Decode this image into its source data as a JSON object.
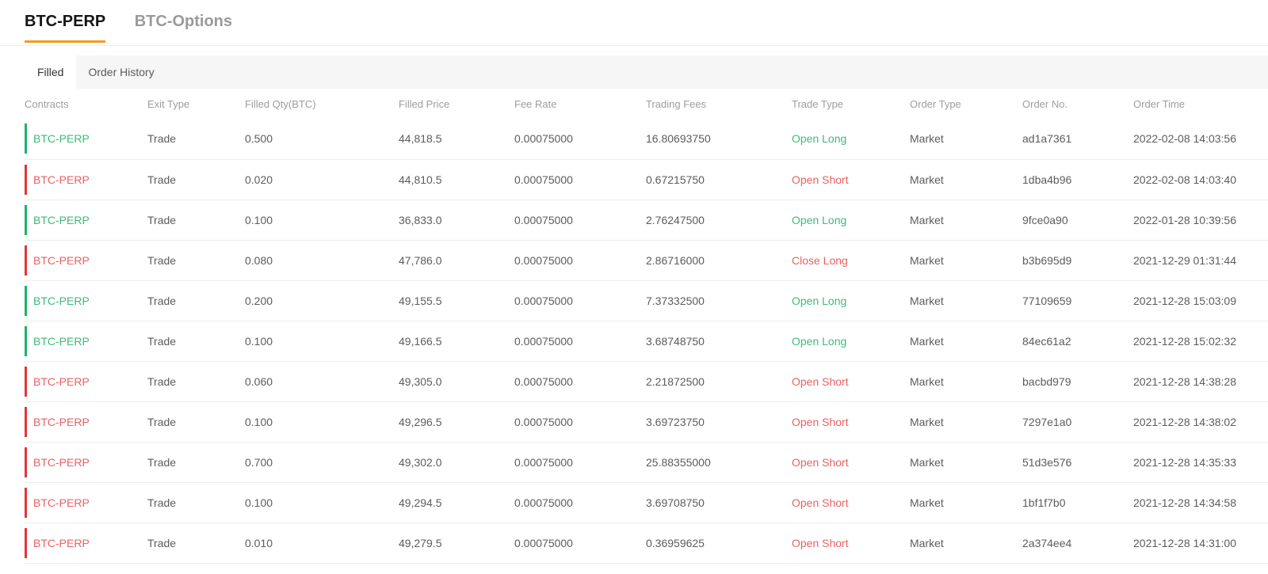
{
  "colors": {
    "green_bar": "#1cb26b",
    "green_text": "#3fb97e",
    "red_bar": "#e23538",
    "red_text": "#e86163",
    "orange": "#f09c1f"
  },
  "primary_tabs": {
    "btc_perp": "BTC-PERP",
    "btc_options": "BTC-Options"
  },
  "secondary_tabs": {
    "filled": "Filled",
    "order_history": "Order History"
  },
  "table": {
    "headers": [
      "Contracts",
      "Exit Type",
      "Filled Qty(BTC)",
      "Filled Price",
      "Fee Rate",
      "Trading Fees",
      "Trade Type",
      "Order Type",
      "Order No.",
      "Order Time"
    ],
    "rows": [
      {
        "color": "green",
        "contract": "BTC-PERP",
        "exit_type": "Trade",
        "filled_qty": "0.500",
        "filled_price": "44,818.5",
        "fee_rate": "0.00075000",
        "trading_fees": "16.80693750",
        "trade_type": "Open Long",
        "order_type": "Market",
        "order_no": "ad1a7361",
        "order_time": "2022-02-08 14:03:56"
      },
      {
        "color": "red",
        "contract": "BTC-PERP",
        "exit_type": "Trade",
        "filled_qty": "0.020",
        "filled_price": "44,810.5",
        "fee_rate": "0.00075000",
        "trading_fees": "0.67215750",
        "trade_type": "Open Short",
        "order_type": "Market",
        "order_no": "1dba4b96",
        "order_time": "2022-02-08 14:03:40"
      },
      {
        "color": "green",
        "contract": "BTC-PERP",
        "exit_type": "Trade",
        "filled_qty": "0.100",
        "filled_price": "36,833.0",
        "fee_rate": "0.00075000",
        "trading_fees": "2.76247500",
        "trade_type": "Open Long",
        "order_type": "Market",
        "order_no": "9fce0a90",
        "order_time": "2022-01-28 10:39:56"
      },
      {
        "color": "red",
        "contract": "BTC-PERP",
        "exit_type": "Trade",
        "filled_qty": "0.080",
        "filled_price": "47,786.0",
        "fee_rate": "0.00075000",
        "trading_fees": "2.86716000",
        "trade_type": "Close Long",
        "order_type": "Market",
        "order_no": "b3b695d9",
        "order_time": "2021-12-29 01:31:44"
      },
      {
        "color": "green",
        "contract": "BTC-PERP",
        "exit_type": "Trade",
        "filled_qty": "0.200",
        "filled_price": "49,155.5",
        "fee_rate": "0.00075000",
        "trading_fees": "7.37332500",
        "trade_type": "Open Long",
        "order_type": "Market",
        "order_no": "77109659",
        "order_time": "2021-12-28 15:03:09"
      },
      {
        "color": "green",
        "contract": "BTC-PERP",
        "exit_type": "Trade",
        "filled_qty": "0.100",
        "filled_price": "49,166.5",
        "fee_rate": "0.00075000",
        "trading_fees": "3.68748750",
        "trade_type": "Open Long",
        "order_type": "Market",
        "order_no": "84ec61a2",
        "order_time": "2021-12-28 15:02:32"
      },
      {
        "color": "red",
        "contract": "BTC-PERP",
        "exit_type": "Trade",
        "filled_qty": "0.060",
        "filled_price": "49,305.0",
        "fee_rate": "0.00075000",
        "trading_fees": "2.21872500",
        "trade_type": "Open Short",
        "order_type": "Market",
        "order_no": "bacbd979",
        "order_time": "2021-12-28 14:38:28"
      },
      {
        "color": "red",
        "contract": "BTC-PERP",
        "exit_type": "Trade",
        "filled_qty": "0.100",
        "filled_price": "49,296.5",
        "fee_rate": "0.00075000",
        "trading_fees": "3.69723750",
        "trade_type": "Open Short",
        "order_type": "Market",
        "order_no": "7297e1a0",
        "order_time": "2021-12-28 14:38:02"
      },
      {
        "color": "red",
        "contract": "BTC-PERP",
        "exit_type": "Trade",
        "filled_qty": "0.700",
        "filled_price": "49,302.0",
        "fee_rate": "0.00075000",
        "trading_fees": "25.88355000",
        "trade_type": "Open Short",
        "order_type": "Market",
        "order_no": "51d3e576",
        "order_time": "2021-12-28 14:35:33"
      },
      {
        "color": "red",
        "contract": "BTC-PERP",
        "exit_type": "Trade",
        "filled_qty": "0.100",
        "filled_price": "49,294.5",
        "fee_rate": "0.00075000",
        "trading_fees": "3.69708750",
        "trade_type": "Open Short",
        "order_type": "Market",
        "order_no": "1bf1f7b0",
        "order_time": "2021-12-28 14:34:58"
      },
      {
        "color": "red",
        "contract": "BTC-PERP",
        "exit_type": "Trade",
        "filled_qty": "0.010",
        "filled_price": "49,279.5",
        "fee_rate": "0.00075000",
        "trading_fees": "0.36959625",
        "trade_type": "Open Short",
        "order_type": "Market",
        "order_no": "2a374ee4",
        "order_time": "2021-12-28 14:31:00"
      }
    ]
  }
}
